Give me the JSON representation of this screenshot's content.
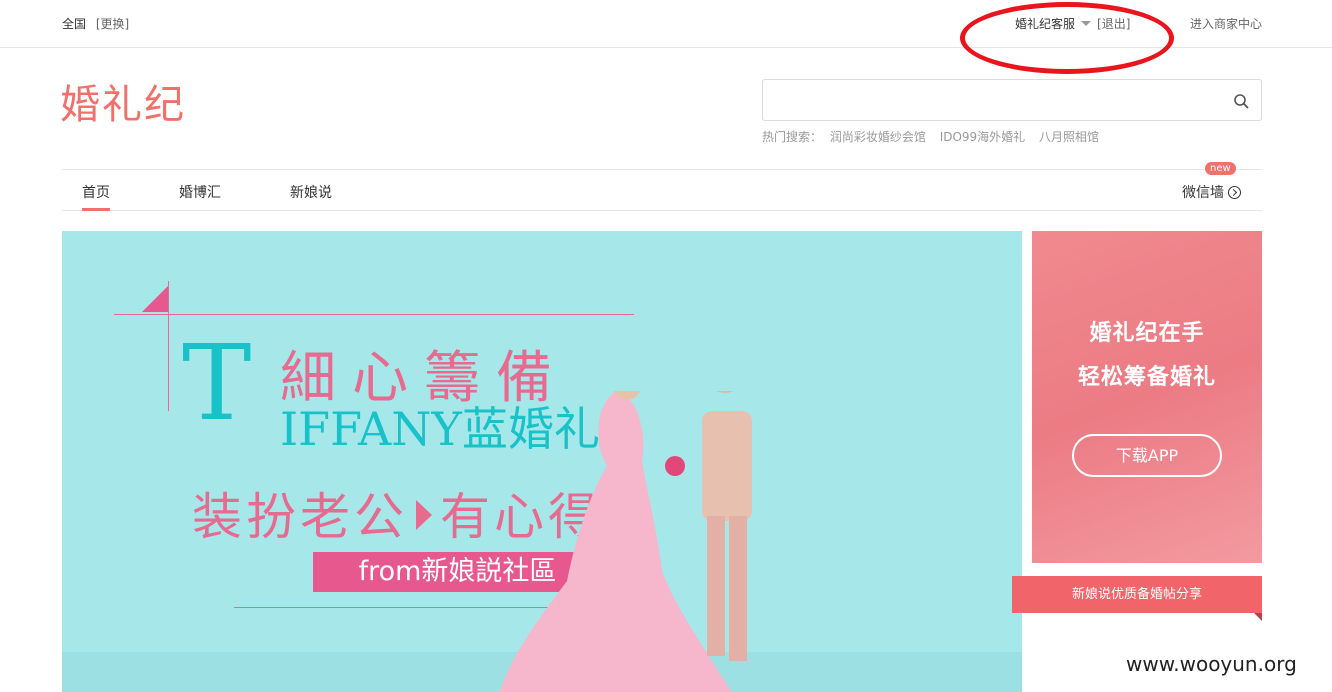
{
  "topbar": {
    "region": "全国",
    "change": "[更换]",
    "user": "婚礼纪客服",
    "logout": "[退出]",
    "merchant": "进入商家中心"
  },
  "logo": "婚礼纪",
  "search": {
    "placeholder": "",
    "hot_label": "热门搜索：",
    "hot": [
      "润尚彩妆婚纱会馆",
      "IDO99海外婚礼",
      "八月照相馆"
    ]
  },
  "nav": {
    "items": [
      "首页",
      "婚博汇",
      "新娘说"
    ],
    "wx": "微信墙",
    "badge": "new"
  },
  "banner": {
    "big_letter": "T",
    "line1": "細心籌備",
    "line1b": "IFFANY蓝婚礼",
    "line2a": "装扮老公",
    "line2b": "有心得",
    "from": "from新娘説社區"
  },
  "side_ad": {
    "line1": "婚礼纪在手",
    "line2": "轻松筹备婚礼",
    "button": "下载APP"
  },
  "share": "新娘说优质备婚帖分享",
  "watermark": "www.wooyun.org",
  "colors": {
    "accent": "#f2706a",
    "teal": "#18c2c8",
    "pink": "#e66b8f",
    "annotation": "#e8151c"
  }
}
